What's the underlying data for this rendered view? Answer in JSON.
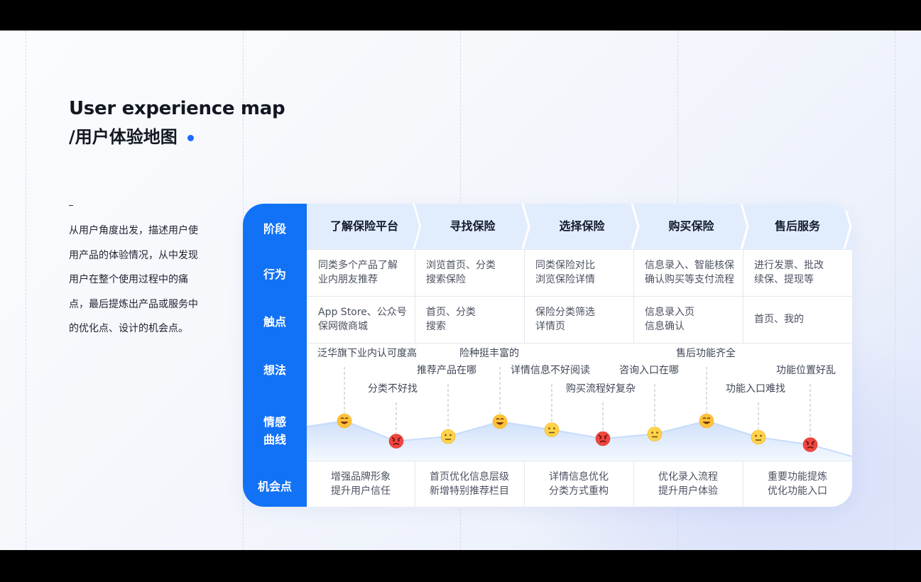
{
  "title": {
    "line1": "User experience map",
    "line2": "/用户体验地图"
  },
  "description": {
    "mark": "_",
    "text": "从用户角度出发，描述用户使用产品的体验情况，从中发现用户在整个使用过程中的痛点，最后提炼出产品或服务中的优化点、设计的机会点。"
  },
  "row_labels": {
    "stage": "阶段",
    "behavior": "行为",
    "touchpoint": "触点",
    "thought": "想法",
    "emotion_1": "情感",
    "emotion_2": "曲线",
    "opportunity": "机会点"
  },
  "stages": [
    "了解保险平台",
    "寻找保险",
    "选择保险",
    "购买保险",
    "售后服务"
  ],
  "behaviors": [
    [
      "同类多个产品了解",
      "业内朋友推荐"
    ],
    [
      "浏览首页、分类",
      "搜索保险"
    ],
    [
      "同类保险对比",
      "浏览保险详情"
    ],
    [
      "信息录入、智能核保",
      "确认购买等支付流程"
    ],
    [
      "进行发票、批改",
      "续保、提现等"
    ]
  ],
  "touchpoints": [
    [
      "App Store、公众号",
      "保网微商城"
    ],
    [
      "首页、分类",
      "搜索"
    ],
    [
      "保险分类筛选",
      "详情页"
    ],
    [
      "信息录入页",
      "信息确认"
    ],
    [
      "首页、我的"
    ]
  ],
  "thoughts": [
    {
      "text": "泛华旗下业内认可度高",
      "emotion": "happy",
      "level": 0.72
    },
    {
      "text": "分类不好找",
      "emotion": "angry",
      "level": 0.15
    },
    {
      "text": "推荐产品在哪",
      "emotion": "neutral",
      "level": 0.28
    },
    {
      "text": "险种挺丰富的",
      "emotion": "happy",
      "level": 0.7
    },
    {
      "text": "详情信息不好阅读",
      "emotion": "neutral",
      "level": 0.47
    },
    {
      "text": "购买流程好复杂",
      "emotion": "angry",
      "level": 0.22
    },
    {
      "text": "咨询入口在哪",
      "emotion": "neutral",
      "level": 0.35
    },
    {
      "text": "售后功能齐全",
      "emotion": "happy",
      "level": 0.72
    },
    {
      "text": "功能入口难找",
      "emotion": "neutral",
      "level": 0.26
    },
    {
      "text": "功能位置好乱",
      "emotion": "angry",
      "level": 0.05
    }
  ],
  "opportunities": [
    [
      "增强品牌形象",
      "提升用户信任"
    ],
    [
      "首页优化信息层级",
      "新增特别推荐栏目"
    ],
    [
      "详情信息优化",
      "分类方式重构"
    ],
    [
      "优化录入流程",
      "提升用户体验"
    ],
    [
      "重要功能提炼",
      "优化功能入口"
    ]
  ],
  "colors": {
    "accent": "#1272f6",
    "dot": "#1b6bff",
    "stage_fill": "#e1edfd",
    "curve_fill": "#dce8fb",
    "happy_face": "#ffc23a",
    "neutral_face": "#ffd24a",
    "angry_face": "#f0463f",
    "grid": "#e2e6ee"
  }
}
